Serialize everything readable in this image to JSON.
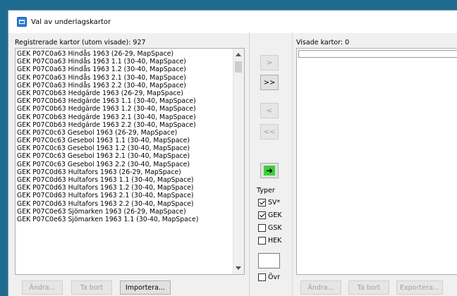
{
  "window": {
    "title": "Val av underlagskartor"
  },
  "left_panel": {
    "label": "Registrerade kartor (utom visade): 927",
    "items": [
      "GEK P07C0a63 Hindås 1963 (26-29, MapSpace)",
      "GEK P07C0a63 Hindås 1963 1.1 (30-40, MapSpace)",
      "GEK P07C0a63 Hindås 1963 1.2 (30-40, MapSpace)",
      "GEK P07C0a63 Hindås 1963 2.1 (30-40, MapSpace)",
      "GEK P07C0a63 Hindås 1963 2.2 (30-40, MapSpace)",
      "GEK P07C0b63 Hedgärde 1963 (26-29, MapSpace)",
      "GEK P07C0b63 Hedgärde 1963 1.1 (30-40, MapSpace)",
      "GEK P07C0b63 Hedgärde 1963 1.2 (30-40, MapSpace)",
      "GEK P07C0b63 Hedgärde 1963 2.1 (30-40, MapSpace)",
      "GEK P07C0b63 Hedgärde 1963 2.2 (30-40, MapSpace)",
      "GEK P07C0c63 Gesebol 1963 (26-29, MapSpace)",
      "GEK P07C0c63 Gesebol 1963 1.1 (30-40, MapSpace)",
      "GEK P07C0c63 Gesebol 1963 1.2 (30-40, MapSpace)",
      "GEK P07C0c63 Gesebol 1963 2.1 (30-40, MapSpace)",
      "GEK P07C0c63 Gesebol 1963 2.2 (30-40, MapSpace)",
      "GEK P07C0d63 Hultafors 1963 (26-29, MapSpace)",
      "GEK P07C0d63 Hultafors 1963 1.1 (30-40, MapSpace)",
      "GEK P07C0d63 Hultafors 1963 1.2 (30-40, MapSpace)",
      "GEK P07C0d63 Hultafors 1963 2.1 (30-40, MapSpace)",
      "GEK P07C0d63 Hultafors 1963 2.2 (30-40, MapSpace)",
      "GEK P07C0e63 Sjömarken 1963 (26-29, MapSpace)",
      "GEK P07C0e63 Sjömarken 1963 1.1 (30-40, MapSpace)"
    ],
    "buttons": {
      "change": "Ändra...",
      "remove": "Ta bort",
      "import": "Importera..."
    }
  },
  "middle": {
    "move_right": ">",
    "move_all_right": ">>",
    "move_left": "<",
    "move_all_left": "<<",
    "go_icon": "arrow-right-icon",
    "types_label": "Typer",
    "types": [
      {
        "label": "SV*",
        "checked": true
      },
      {
        "label": "GEK",
        "checked": true
      },
      {
        "label": "GSK",
        "checked": false
      },
      {
        "label": "HEK",
        "checked": false
      }
    ],
    "other": {
      "label": "Övr",
      "checked": false
    }
  },
  "right_panel": {
    "label": "Visade kartor: 0",
    "buttons": {
      "change": "Ändra...",
      "remove": "Ta bort",
      "export": "Exportera..."
    }
  },
  "colors": {
    "desktop": "#1f6b8f",
    "go_button": "#3ad13a"
  }
}
